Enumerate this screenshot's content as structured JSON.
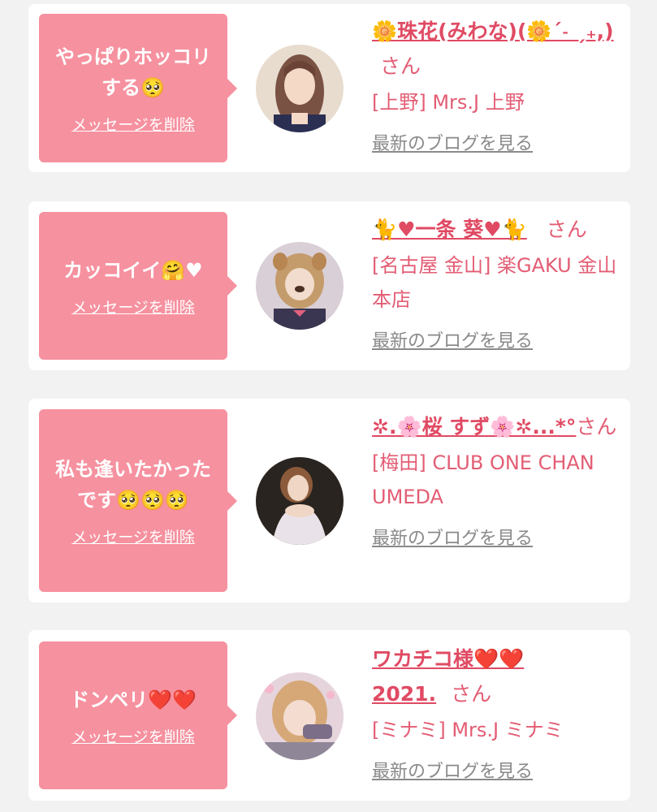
{
  "posts": [
    {
      "message": "やっぱりホッコリする🥺",
      "delete_label": "メッセージを削除",
      "name": "🌼珠花(みわな)(🌼ˊ˗ ˏ₊,)",
      "honorific": "さん",
      "shop": "[上野] Mrs.J 上野",
      "blog_label": "最新のブログを見る"
    },
    {
      "message": "カッコイイ🤗♥",
      "delete_label": "メッセージを削除",
      "name": "🐈♥一条 葵♥🐈",
      "honorific": "さん",
      "shop": "[名古屋 金山] 楽GAKU 金山本店",
      "blog_label": "最新のブログを見る"
    },
    {
      "message": "私も逢いたかったです🥺🥺🥺",
      "delete_label": "メッセージを削除",
      "name": "✲.🌸桜 すず🌸✲...*°",
      "honorific": "さん",
      "shop": "[梅田] CLUB ONE CHAN UMEDA",
      "blog_label": "最新のブログを見る"
    },
    {
      "message": "ドンペリ❤️❤️",
      "delete_label": "メッセージを削除",
      "name": "ワカチコ様❤️❤️2021.",
      "honorific": "さん",
      "shop": "[ミナミ] Mrs.J ミナミ",
      "blog_label": "最新のブログを見る"
    }
  ],
  "colors": {
    "bubble": "#f6919f",
    "accent": "#e04a63",
    "muted": "#8a8a8a",
    "background": "#f2f2f2"
  }
}
